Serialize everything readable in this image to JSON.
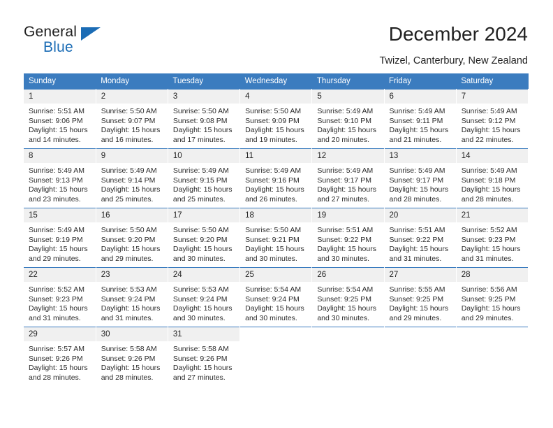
{
  "brand": {
    "name_part1": "General",
    "name_part2": "Blue",
    "triangle_color": "#1b6cb5"
  },
  "header": {
    "title": "December 2024",
    "subtitle": "Twizel, Canterbury, New Zealand"
  },
  "theme": {
    "header_blue": "#3b7cbf",
    "daynum_bg": "#f0f0f0",
    "text": "#222222"
  },
  "weekday_headers": [
    "Sunday",
    "Monday",
    "Tuesday",
    "Wednesday",
    "Thursday",
    "Friday",
    "Saturday"
  ],
  "weeks": [
    [
      {
        "day": "1",
        "sunrise": "Sunrise: 5:51 AM",
        "sunset": "Sunset: 9:06 PM",
        "daylight_line1": "Daylight: 15 hours",
        "daylight_line2": "and 14 minutes."
      },
      {
        "day": "2",
        "sunrise": "Sunrise: 5:50 AM",
        "sunset": "Sunset: 9:07 PM",
        "daylight_line1": "Daylight: 15 hours",
        "daylight_line2": "and 16 minutes."
      },
      {
        "day": "3",
        "sunrise": "Sunrise: 5:50 AM",
        "sunset": "Sunset: 9:08 PM",
        "daylight_line1": "Daylight: 15 hours",
        "daylight_line2": "and 17 minutes."
      },
      {
        "day": "4",
        "sunrise": "Sunrise: 5:50 AM",
        "sunset": "Sunset: 9:09 PM",
        "daylight_line1": "Daylight: 15 hours",
        "daylight_line2": "and 19 minutes."
      },
      {
        "day": "5",
        "sunrise": "Sunrise: 5:49 AM",
        "sunset": "Sunset: 9:10 PM",
        "daylight_line1": "Daylight: 15 hours",
        "daylight_line2": "and 20 minutes."
      },
      {
        "day": "6",
        "sunrise": "Sunrise: 5:49 AM",
        "sunset": "Sunset: 9:11 PM",
        "daylight_line1": "Daylight: 15 hours",
        "daylight_line2": "and 21 minutes."
      },
      {
        "day": "7",
        "sunrise": "Sunrise: 5:49 AM",
        "sunset": "Sunset: 9:12 PM",
        "daylight_line1": "Daylight: 15 hours",
        "daylight_line2": "and 22 minutes."
      }
    ],
    [
      {
        "day": "8",
        "sunrise": "Sunrise: 5:49 AM",
        "sunset": "Sunset: 9:13 PM",
        "daylight_line1": "Daylight: 15 hours",
        "daylight_line2": "and 23 minutes."
      },
      {
        "day": "9",
        "sunrise": "Sunrise: 5:49 AM",
        "sunset": "Sunset: 9:14 PM",
        "daylight_line1": "Daylight: 15 hours",
        "daylight_line2": "and 25 minutes."
      },
      {
        "day": "10",
        "sunrise": "Sunrise: 5:49 AM",
        "sunset": "Sunset: 9:15 PM",
        "daylight_line1": "Daylight: 15 hours",
        "daylight_line2": "and 25 minutes."
      },
      {
        "day": "11",
        "sunrise": "Sunrise: 5:49 AM",
        "sunset": "Sunset: 9:16 PM",
        "daylight_line1": "Daylight: 15 hours",
        "daylight_line2": "and 26 minutes."
      },
      {
        "day": "12",
        "sunrise": "Sunrise: 5:49 AM",
        "sunset": "Sunset: 9:17 PM",
        "daylight_line1": "Daylight: 15 hours",
        "daylight_line2": "and 27 minutes."
      },
      {
        "day": "13",
        "sunrise": "Sunrise: 5:49 AM",
        "sunset": "Sunset: 9:17 PM",
        "daylight_line1": "Daylight: 15 hours",
        "daylight_line2": "and 28 minutes."
      },
      {
        "day": "14",
        "sunrise": "Sunrise: 5:49 AM",
        "sunset": "Sunset: 9:18 PM",
        "daylight_line1": "Daylight: 15 hours",
        "daylight_line2": "and 28 minutes."
      }
    ],
    [
      {
        "day": "15",
        "sunrise": "Sunrise: 5:49 AM",
        "sunset": "Sunset: 9:19 PM",
        "daylight_line1": "Daylight: 15 hours",
        "daylight_line2": "and 29 minutes."
      },
      {
        "day": "16",
        "sunrise": "Sunrise: 5:50 AM",
        "sunset": "Sunset: 9:20 PM",
        "daylight_line1": "Daylight: 15 hours",
        "daylight_line2": "and 29 minutes."
      },
      {
        "day": "17",
        "sunrise": "Sunrise: 5:50 AM",
        "sunset": "Sunset: 9:20 PM",
        "daylight_line1": "Daylight: 15 hours",
        "daylight_line2": "and 30 minutes."
      },
      {
        "day": "18",
        "sunrise": "Sunrise: 5:50 AM",
        "sunset": "Sunset: 9:21 PM",
        "daylight_line1": "Daylight: 15 hours",
        "daylight_line2": "and 30 minutes."
      },
      {
        "day": "19",
        "sunrise": "Sunrise: 5:51 AM",
        "sunset": "Sunset: 9:22 PM",
        "daylight_line1": "Daylight: 15 hours",
        "daylight_line2": "and 30 minutes."
      },
      {
        "day": "20",
        "sunrise": "Sunrise: 5:51 AM",
        "sunset": "Sunset: 9:22 PM",
        "daylight_line1": "Daylight: 15 hours",
        "daylight_line2": "and 31 minutes."
      },
      {
        "day": "21",
        "sunrise": "Sunrise: 5:52 AM",
        "sunset": "Sunset: 9:23 PM",
        "daylight_line1": "Daylight: 15 hours",
        "daylight_line2": "and 31 minutes."
      }
    ],
    [
      {
        "day": "22",
        "sunrise": "Sunrise: 5:52 AM",
        "sunset": "Sunset: 9:23 PM",
        "daylight_line1": "Daylight: 15 hours",
        "daylight_line2": "and 31 minutes."
      },
      {
        "day": "23",
        "sunrise": "Sunrise: 5:53 AM",
        "sunset": "Sunset: 9:24 PM",
        "daylight_line1": "Daylight: 15 hours",
        "daylight_line2": "and 31 minutes."
      },
      {
        "day": "24",
        "sunrise": "Sunrise: 5:53 AM",
        "sunset": "Sunset: 9:24 PM",
        "daylight_line1": "Daylight: 15 hours",
        "daylight_line2": "and 30 minutes."
      },
      {
        "day": "25",
        "sunrise": "Sunrise: 5:54 AM",
        "sunset": "Sunset: 9:24 PM",
        "daylight_line1": "Daylight: 15 hours",
        "daylight_line2": "and 30 minutes."
      },
      {
        "day": "26",
        "sunrise": "Sunrise: 5:54 AM",
        "sunset": "Sunset: 9:25 PM",
        "daylight_line1": "Daylight: 15 hours",
        "daylight_line2": "and 30 minutes."
      },
      {
        "day": "27",
        "sunrise": "Sunrise: 5:55 AM",
        "sunset": "Sunset: 9:25 PM",
        "daylight_line1": "Daylight: 15 hours",
        "daylight_line2": "and 29 minutes."
      },
      {
        "day": "28",
        "sunrise": "Sunrise: 5:56 AM",
        "sunset": "Sunset: 9:25 PM",
        "daylight_line1": "Daylight: 15 hours",
        "daylight_line2": "and 29 minutes."
      }
    ],
    [
      {
        "day": "29",
        "sunrise": "Sunrise: 5:57 AM",
        "sunset": "Sunset: 9:26 PM",
        "daylight_line1": "Daylight: 15 hours",
        "daylight_line2": "and 28 minutes."
      },
      {
        "day": "30",
        "sunrise": "Sunrise: 5:58 AM",
        "sunset": "Sunset: 9:26 PM",
        "daylight_line1": "Daylight: 15 hours",
        "daylight_line2": "and 28 minutes."
      },
      {
        "day": "31",
        "sunrise": "Sunrise: 5:58 AM",
        "sunset": "Sunset: 9:26 PM",
        "daylight_line1": "Daylight: 15 hours",
        "daylight_line2": "and 27 minutes."
      },
      {
        "day": "",
        "sunrise": "",
        "sunset": "",
        "daylight_line1": "",
        "daylight_line2": ""
      },
      {
        "day": "",
        "sunrise": "",
        "sunset": "",
        "daylight_line1": "",
        "daylight_line2": ""
      },
      {
        "day": "",
        "sunrise": "",
        "sunset": "",
        "daylight_line1": "",
        "daylight_line2": ""
      },
      {
        "day": "",
        "sunrise": "",
        "sunset": "",
        "daylight_line1": "",
        "daylight_line2": ""
      }
    ]
  ]
}
